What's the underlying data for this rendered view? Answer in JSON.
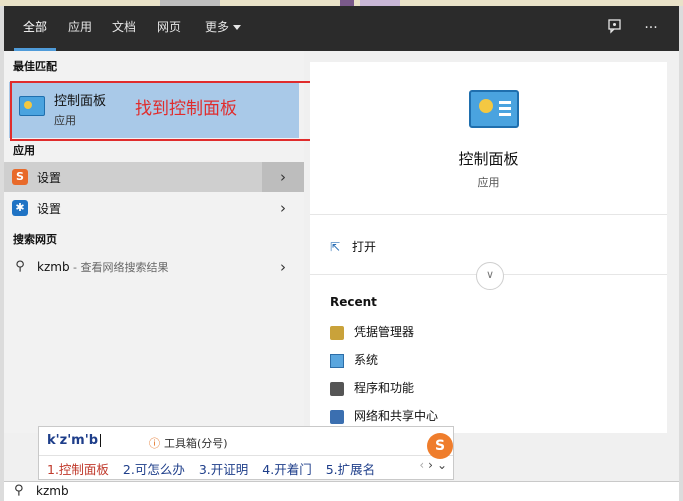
{
  "tabs": [
    {
      "label": "全部",
      "active": true
    },
    {
      "label": "应用",
      "active": false
    },
    {
      "label": "文档",
      "active": false
    },
    {
      "label": "网页",
      "active": false
    },
    {
      "label": "更多",
      "active": false
    }
  ],
  "topbar_icons": {
    "feedback": "feedback-icon",
    "more": "···"
  },
  "left": {
    "best_match_label": "最佳匹配",
    "best_match": {
      "title": "控制面板",
      "subtitle": "应用",
      "icon": "control-panel-icon"
    },
    "annotation": "找到控制面板",
    "apps_label": "应用",
    "apps": [
      {
        "label": "设置",
        "icon": "sogou-settings-icon",
        "highlighted": true
      },
      {
        "label": "设置",
        "icon": "gear-icon",
        "highlighted": false
      }
    ],
    "web_label": "搜索网页",
    "web_item": {
      "query": "kzmb",
      "suffix": " - 查看网络搜索结果"
    }
  },
  "right": {
    "title": "控制面板",
    "subtitle": "应用",
    "open_label": "打开",
    "recent_label": "Recent",
    "recent": [
      {
        "label": "凭据管理器",
        "icon": "credential-manager-icon"
      },
      {
        "label": "系统",
        "icon": "system-icon"
      },
      {
        "label": "程序和功能",
        "icon": "programs-icon"
      },
      {
        "label": "网络和共享中心",
        "icon": "network-icon"
      }
    ]
  },
  "ime": {
    "pinyin": "k'z'm'b",
    "toolbox": "工具箱(分号)",
    "candidates": [
      "1.控制面板",
      "2.可怎么办",
      "3.开证明",
      "4.开着门",
      "5.扩展名"
    ]
  },
  "search": {
    "value": "kzmb"
  },
  "colors": {
    "accent": "#4f9bd9",
    "selection": "#a9c9e8",
    "annotation": "#e02c2c",
    "topbar": "#2b2b2b"
  }
}
